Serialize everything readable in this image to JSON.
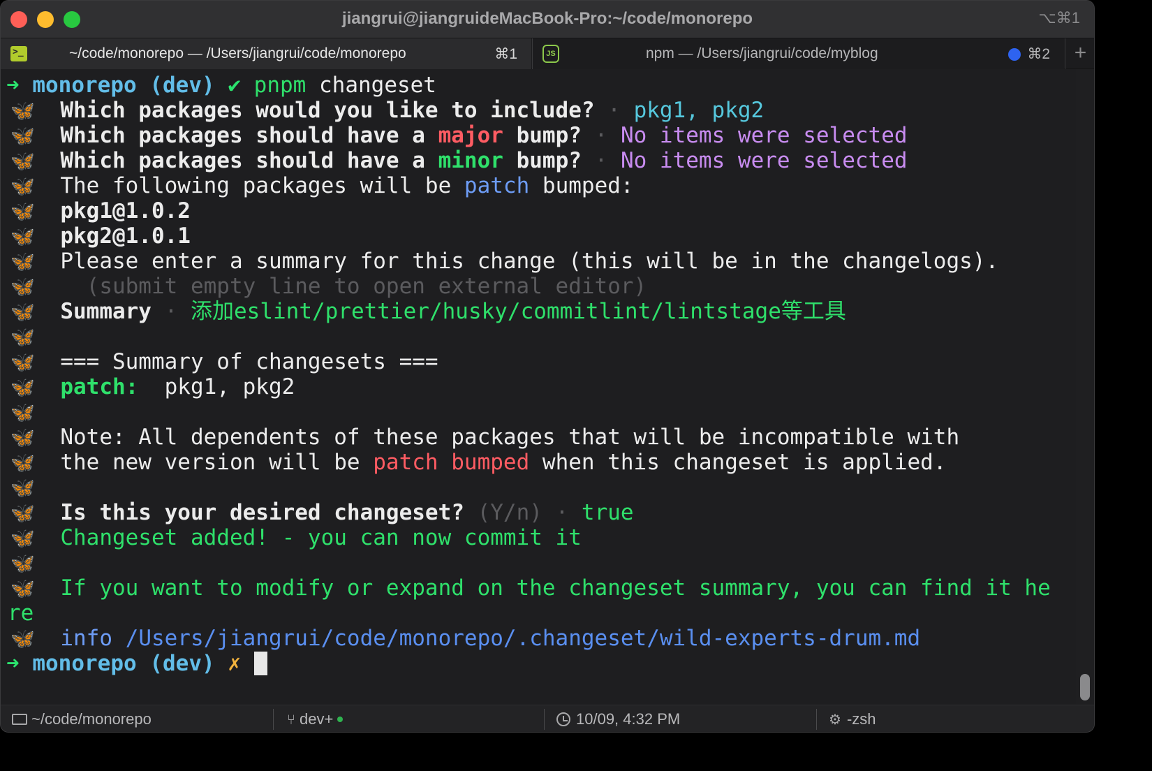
{
  "window": {
    "title": "jiangrui@jiangruideMacBook-Pro:~/code/monorepo",
    "shortcut": "⌥⌘1"
  },
  "tabs": [
    {
      "label": "~/code/monorepo — /Users/jiangrui/code/monorepo",
      "key": "⌘1",
      "icon": "terminal-icon"
    },
    {
      "label": "npm — /Users/jiangrui/code/myblog",
      "key": "⌘2",
      "icon": "nodejs-icon"
    }
  ],
  "new_tab_label": "+",
  "terminal": {
    "prompt": {
      "arrow": "➜",
      "dir": "monorepo",
      "branch": "(dev)",
      "check": "✔",
      "cross": "✗",
      "cmd_name": "pnpm",
      "cmd_arg": "changeset"
    },
    "butterfly": "🦋",
    "q_include": "Which packages would you like to include?",
    "sep": "·",
    "include_answer": "pkg1, pkg2",
    "q_have_a": "Which packages should have a",
    "major": "major",
    "minor": "minor",
    "bump_q": "bump?",
    "no_items": "No items were selected",
    "following": "The following packages will be",
    "patch": "patch",
    "bumped": "bumped:",
    "pkg1": "pkg1@1.0.2",
    "pkg2": "pkg2@1.0.1",
    "enter_summary": "Please enter a summary for this change (this will be in the changelogs).",
    "submit_hint": "(submit empty line to open external editor)",
    "summary_label": "Summary",
    "summary_value": "添加eslint/prettier/husky/commitlint/lintstage等工具",
    "summary_header": "=== Summary of changesets ===",
    "patch_label": "patch:",
    "patch_pkgs": "  pkg1, pkg2",
    "note_1": "Note: All dependents of these packages that will be incompatible with",
    "note_2a": "the new version will be",
    "note_2b": "patch bumped",
    "note_2c": "when this changeset is applied.",
    "desired": "Is this your desired changeset?",
    "yn": "(Y/n)",
    "desired_answer": "true",
    "added": "Changeset added! - you can now commit it",
    "modify_1": "If you want to modify or expand on the changeset summary, you can find it he",
    "modify_2": "re",
    "info_label": "info",
    "info_path": "/Users/jiangrui/code/monorepo/.changeset/wild-experts-drum.md"
  },
  "status": {
    "cwd": "~/code/monorepo",
    "branch": "dev+",
    "time": "10/09, 4:32 PM",
    "shell": "-zsh"
  }
}
